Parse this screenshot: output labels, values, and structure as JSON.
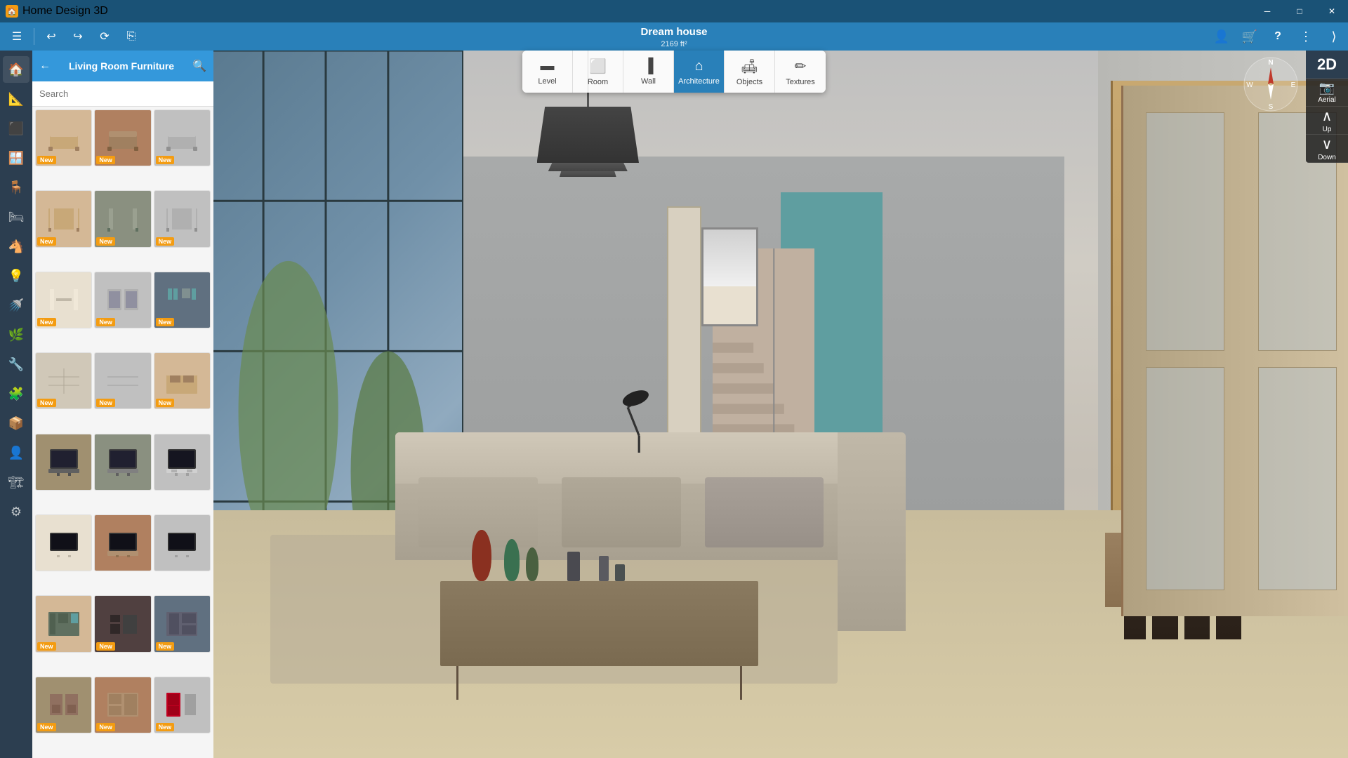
{
  "titlebar": {
    "app_name": "Home Design 3D",
    "win_min": "─",
    "win_max": "□",
    "win_close": "✕"
  },
  "toolbar": {
    "menu_icon": "☰",
    "undo": "↩",
    "redo": "↪",
    "something": "⟳",
    "copy": "⎘"
  },
  "project": {
    "title": "Dream house",
    "size": "2169 ft²"
  },
  "topnav": {
    "buttons": [
      {
        "label": "Level",
        "icon": "▬",
        "active": false
      },
      {
        "label": "Room",
        "icon": "⬜",
        "active": false
      },
      {
        "label": "Wall",
        "icon": "▐",
        "active": false
      },
      {
        "label": "Architecture",
        "icon": "🏠",
        "active": true
      },
      {
        "label": "Objects",
        "icon": "🛋",
        "active": false
      },
      {
        "label": "Textures",
        "icon": "✏",
        "active": false
      }
    ]
  },
  "right_controls": {
    "buttons": [
      {
        "icon": "👤",
        "label": "account"
      },
      {
        "icon": "🛒",
        "label": "store"
      },
      {
        "icon": "?",
        "label": "help"
      },
      {
        "icon": "⋮",
        "label": "more"
      },
      {
        "icon": "⟨",
        "label": "collapse"
      }
    ]
  },
  "view_controls": {
    "view2d": "2D",
    "aerial": "Aerial",
    "up": "Up",
    "down": "Down"
  },
  "panel": {
    "title": "Living Room Furniture",
    "search_placeholder": "Search",
    "back_icon": "←",
    "search_icon": "🔍"
  },
  "categories": [
    {
      "icon": "🏠",
      "label": "home"
    },
    {
      "icon": "📐",
      "label": "plan"
    },
    {
      "icon": "⬛",
      "label": "floor"
    },
    {
      "icon": "🪟",
      "label": "walls"
    },
    {
      "icon": "🪑",
      "label": "furniture",
      "active": true
    },
    {
      "icon": "🛏",
      "label": "bedroom"
    },
    {
      "icon": "🐴",
      "label": "decor"
    },
    {
      "icon": "💡",
      "label": "lighting"
    },
    {
      "icon": "🚿",
      "label": "bathroom"
    },
    {
      "icon": "🌿",
      "label": "plants"
    },
    {
      "icon": "🔧",
      "label": "fixtures"
    },
    {
      "icon": "🧩",
      "label": "misc1"
    },
    {
      "icon": "📦",
      "label": "misc2"
    },
    {
      "icon": "👤",
      "label": "person"
    },
    {
      "icon": "🏗",
      "label": "construction"
    },
    {
      "icon": "⚙",
      "label": "settings"
    }
  ],
  "furniture_items": [
    {
      "id": 1,
      "color": "fi-color-1",
      "new": true,
      "icon": "🪑"
    },
    {
      "id": 2,
      "color": "fi-color-4",
      "new": true,
      "icon": "🪑"
    },
    {
      "id": 3,
      "color": "fi-color-3",
      "new": true,
      "icon": "🪑"
    },
    {
      "id": 4,
      "color": "fi-color-1",
      "new": true,
      "icon": "🗄"
    },
    {
      "id": 5,
      "color": "fi-color-2",
      "new": true,
      "icon": "🗄"
    },
    {
      "id": 6,
      "color": "fi-color-3",
      "new": true,
      "icon": "🗄"
    },
    {
      "id": 7,
      "color": "fi-color-5",
      "new": true,
      "icon": "🗄"
    },
    {
      "id": 8,
      "color": "fi-color-3",
      "new": true,
      "icon": "🗄"
    },
    {
      "id": 9,
      "color": "fi-color-8",
      "new": true,
      "icon": "🗄"
    },
    {
      "id": 10,
      "color": "fi-color-2",
      "new": true,
      "icon": "🗄"
    },
    {
      "id": 11,
      "color": "fi-color-6",
      "new": true,
      "icon": "🗄"
    },
    {
      "id": 12,
      "color": "fi-color-3",
      "new": true,
      "icon": "🗄"
    },
    {
      "id": 13,
      "color": "fi-color-7",
      "new": false,
      "icon": "📺"
    },
    {
      "id": 14,
      "color": "fi-color-2",
      "new": false,
      "icon": "📺"
    },
    {
      "id": 15,
      "color": "fi-color-3",
      "new": false,
      "icon": "📺"
    },
    {
      "id": 16,
      "color": "fi-color-5",
      "new": false,
      "icon": "📺"
    },
    {
      "id": 17,
      "color": "fi-color-4",
      "new": false,
      "icon": "📺"
    },
    {
      "id": 18,
      "color": "fi-color-3",
      "new": false,
      "icon": "📺"
    },
    {
      "id": 19,
      "color": "fi-color-1",
      "new": false,
      "icon": "🗄"
    },
    {
      "id": 20,
      "color": "fi-color-2",
      "new": false,
      "icon": "🗄"
    },
    {
      "id": 21,
      "color": "fi-color-8",
      "new": false,
      "icon": "🗄"
    },
    {
      "id": 22,
      "color": "fi-color-1",
      "new": true,
      "icon": "🗄"
    },
    {
      "id": 23,
      "color": "fi-color-9",
      "new": true,
      "icon": "🗄"
    },
    {
      "id": 24,
      "color": "fi-color-6",
      "new": true,
      "icon": "🗄"
    },
    {
      "id": 25,
      "color": "fi-color-7",
      "new": true,
      "icon": "🗄"
    },
    {
      "id": 26,
      "color": "fi-color-4",
      "new": true,
      "icon": "🗄"
    },
    {
      "id": 27,
      "color": "fi-color-3",
      "new": true,
      "icon": "🗄"
    }
  ],
  "badge_label": "New",
  "colors": {
    "blue": "#2980b9",
    "dark": "#2c3e50",
    "orange": "#f39c12",
    "teal": "#5f9ea0"
  }
}
